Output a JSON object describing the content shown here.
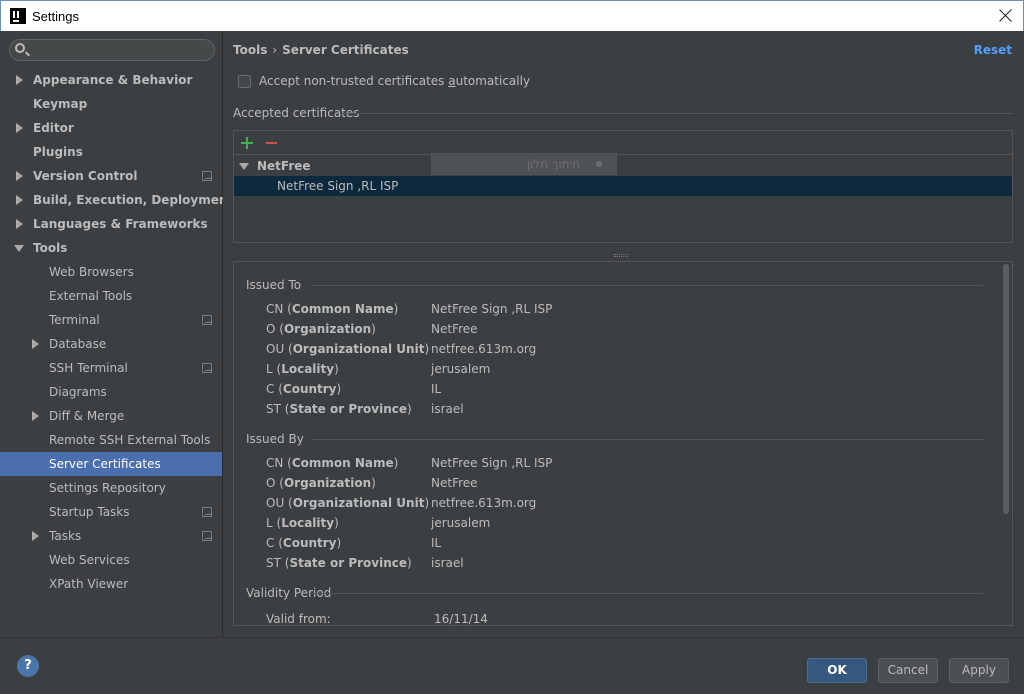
{
  "window": {
    "title": "Settings"
  },
  "search": {
    "placeholder": "",
    "value": ""
  },
  "sidebar": {
    "items": [
      {
        "label": "Appearance & Behavior",
        "level": 0,
        "expandable": true,
        "expanded": false,
        "bold": true
      },
      {
        "label": "Keymap",
        "level": 0,
        "expandable": false,
        "bold": true
      },
      {
        "label": "Editor",
        "level": 0,
        "expandable": true,
        "expanded": false,
        "bold": true
      },
      {
        "label": "Plugins",
        "level": 0,
        "expandable": false,
        "bold": true
      },
      {
        "label": "Version Control",
        "level": 0,
        "expandable": true,
        "expanded": false,
        "bold": true,
        "project_icon": true
      },
      {
        "label": "Build, Execution, Deployment",
        "level": 0,
        "expandable": true,
        "expanded": false,
        "bold": true
      },
      {
        "label": "Languages & Frameworks",
        "level": 0,
        "expandable": true,
        "expanded": false,
        "bold": true
      },
      {
        "label": "Tools",
        "level": 0,
        "expandable": true,
        "expanded": true,
        "bold": true
      },
      {
        "label": "Web Browsers",
        "level": 1
      },
      {
        "label": "External Tools",
        "level": 1
      },
      {
        "label": "Terminal",
        "level": 1,
        "project_icon": true
      },
      {
        "label": "Database",
        "level": 1,
        "expandable": true
      },
      {
        "label": "SSH Terminal",
        "level": 1,
        "project_icon": true
      },
      {
        "label": "Diagrams",
        "level": 1
      },
      {
        "label": "Diff & Merge",
        "level": 1,
        "expandable": true
      },
      {
        "label": "Remote SSH External Tools",
        "level": 1
      },
      {
        "label": "Server Certificates",
        "level": 1,
        "selected": true
      },
      {
        "label": "Settings Repository",
        "level": 1
      },
      {
        "label": "Startup Tasks",
        "level": 1,
        "project_icon": true
      },
      {
        "label": "Tasks",
        "level": 1,
        "expandable": true,
        "project_icon": true
      },
      {
        "label": "Web Services",
        "level": 1
      },
      {
        "label": "XPath Viewer",
        "level": 1
      }
    ]
  },
  "breadcrumb": {
    "parent": "Tools",
    "separator": "›",
    "current": "Server Certificates"
  },
  "reset_label": "Reset",
  "accept_checkbox": {
    "label_before": "Accept non-trusted certificates ",
    "label_mnemonic": "a",
    "label_after": "utomatically",
    "checked": false
  },
  "accepted_section": {
    "title": "Accepted certificates"
  },
  "certificates": {
    "group": "NetFree",
    "item": "NetFree Sign ,RL ISP",
    "ghost_text": "חיתוך חלון"
  },
  "details": {
    "issued_to": {
      "title": "Issued To",
      "rows": [
        {
          "abbr": "CN",
          "name": "Common Name",
          "value": "NetFree Sign ,RL ISP"
        },
        {
          "abbr": "O",
          "name": "Organization",
          "value": "NetFree"
        },
        {
          "abbr": "OU",
          "name": "Organizational Unit",
          "value": "netfree.613m.org"
        },
        {
          "abbr": "L",
          "name": "Locality",
          "value": "jerusalem"
        },
        {
          "abbr": "C",
          "name": "Country",
          "value": "IL"
        },
        {
          "abbr": "ST",
          "name": "State or Province",
          "value": "israel"
        }
      ]
    },
    "issued_by": {
      "title": "Issued By",
      "rows": [
        {
          "abbr": "CN",
          "name": "Common Name",
          "value": "NetFree Sign ,RL ISP"
        },
        {
          "abbr": "O",
          "name": "Organization",
          "value": "NetFree"
        },
        {
          "abbr": "OU",
          "name": "Organizational Unit",
          "value": "netfree.613m.org"
        },
        {
          "abbr": "L",
          "name": "Locality",
          "value": "jerusalem"
        },
        {
          "abbr": "C",
          "name": "Country",
          "value": "IL"
        },
        {
          "abbr": "ST",
          "name": "State or Province",
          "value": "israel"
        }
      ]
    },
    "validity": {
      "title": "Validity Period",
      "valid_from_label": "Valid from:",
      "valid_from_value": "16/11/14"
    }
  },
  "footer": {
    "help": "?",
    "ok": "OK",
    "cancel": "Cancel",
    "apply": "Apply"
  },
  "colors": {
    "accent": "#4b6eaf",
    "link": "#589df6",
    "add": "#3fb34f",
    "remove": "#d34e4e",
    "background": "#3c3f41"
  }
}
